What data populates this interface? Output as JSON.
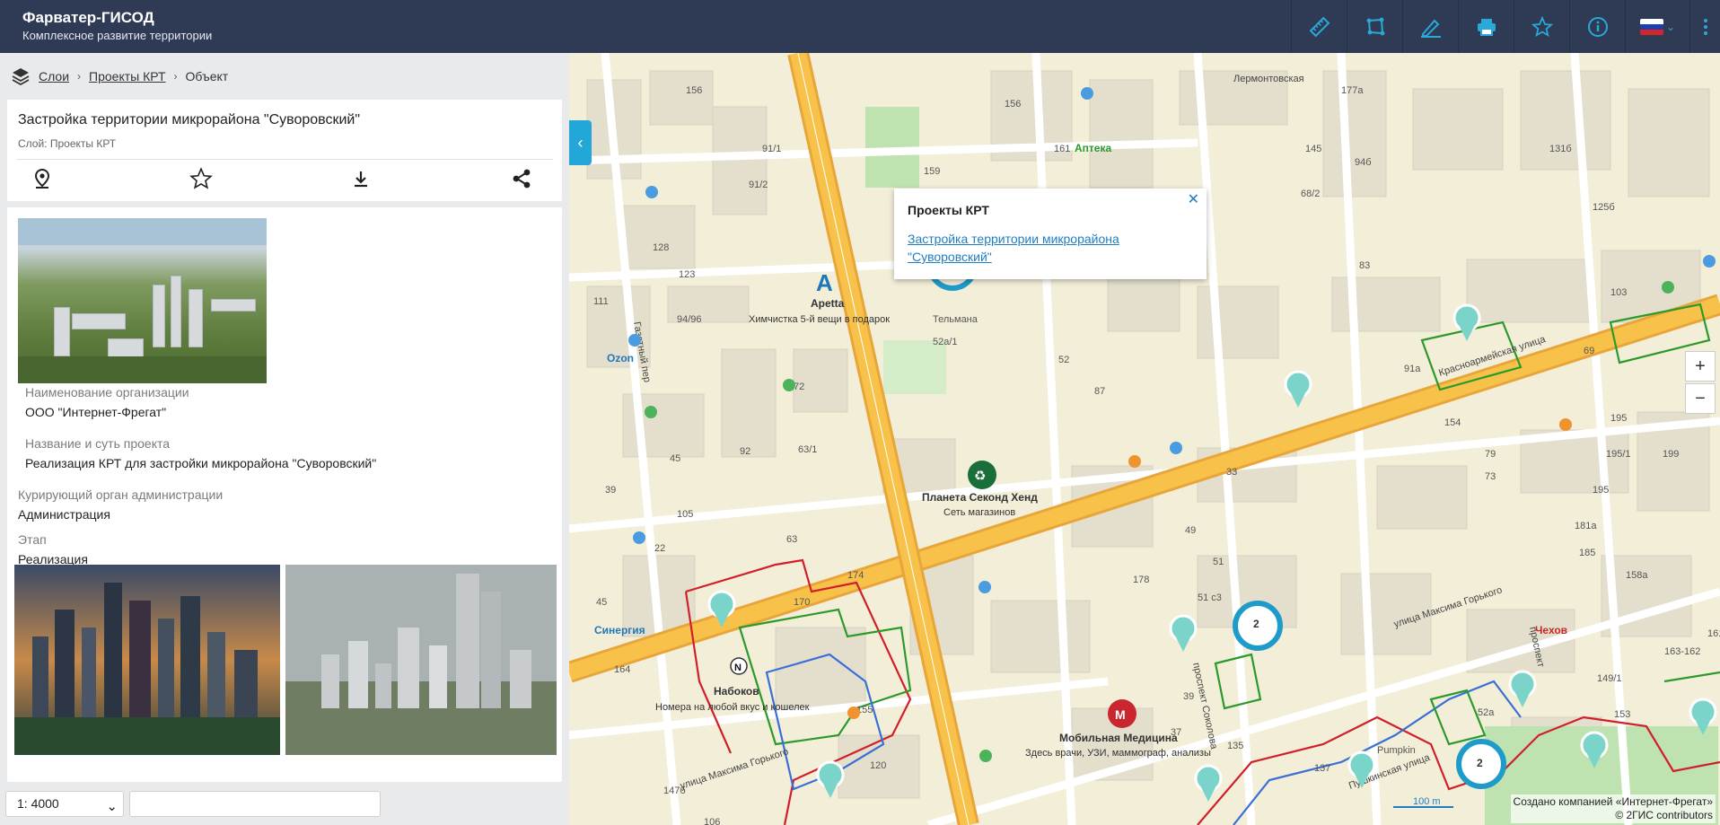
{
  "app": {
    "title": "Фарватер-ГИСОД",
    "subtitle": "Комплексное развитие территории"
  },
  "toolbar": {
    "icons": [
      "ruler-icon",
      "polygon-icon",
      "draw-icon",
      "print-icon",
      "star-icon",
      "info-icon",
      "flag-ru-icon",
      "more-icon"
    ],
    "accent": "#2aa8d8",
    "bar_color": "#2f3a55"
  },
  "breadcrumb": {
    "items": [
      "Слои",
      "Проекты КРТ",
      "Объект"
    ]
  },
  "object": {
    "title": "Застройка территории микрорайона \"Суворовский\"",
    "layer": "Слой: Проекты КРТ"
  },
  "fields": [
    {
      "label": "Наименование организации",
      "value": "ООО \"Интернет-Фрегат\""
    },
    {
      "label": "Название и суть проекта",
      "value": "Реализация КРТ для застройки микрорайона \"Суворовский\""
    },
    {
      "label": "Курирующий орган администрации",
      "value": "Администрация"
    },
    {
      "label": "Этап",
      "value": "Реализация"
    }
  ],
  "scale": {
    "selected": "1: 4000"
  },
  "popup": {
    "title": "Проекты КРТ",
    "link": "Застройка территории микрорайона \"Суворовский\""
  },
  "map": {
    "labels": {
      "apetta": "Apetta",
      "apetta_desc": "Химчистка 5-й вещи в подарок",
      "planet": "Планета Секонд Хенд",
      "planet_desc": "Сеть магазинов",
      "nabokov": "Набоков",
      "nabokov_desc": "Номера на любой вкус и кошелек",
      "med": "Мобильная Медицина",
      "med_desc": "Здесь врачи, УЗИ, маммограф, анализы",
      "ozon": "Ozon",
      "sinergia": "Синергия",
      "apteka": "Аптека",
      "chekhov": "Чехов",
      "street1": "улица Максима Горького",
      "street2": "Красноармейская улица",
      "street3": "Газетный пер",
      "street4": "Пушкинская улица",
      "street5": "проспект Соколова",
      "street6": "Лермонтовская",
      "street7": "Тельмана",
      "cluster": "2",
      "scalebar": "100 m"
    },
    "attribution_line1": "Создано компанией «Интернет-Фрегат»",
    "attribution_line2": "© 2ГИС contributors"
  },
  "zoom": {
    "in": "+",
    "out": "−"
  }
}
